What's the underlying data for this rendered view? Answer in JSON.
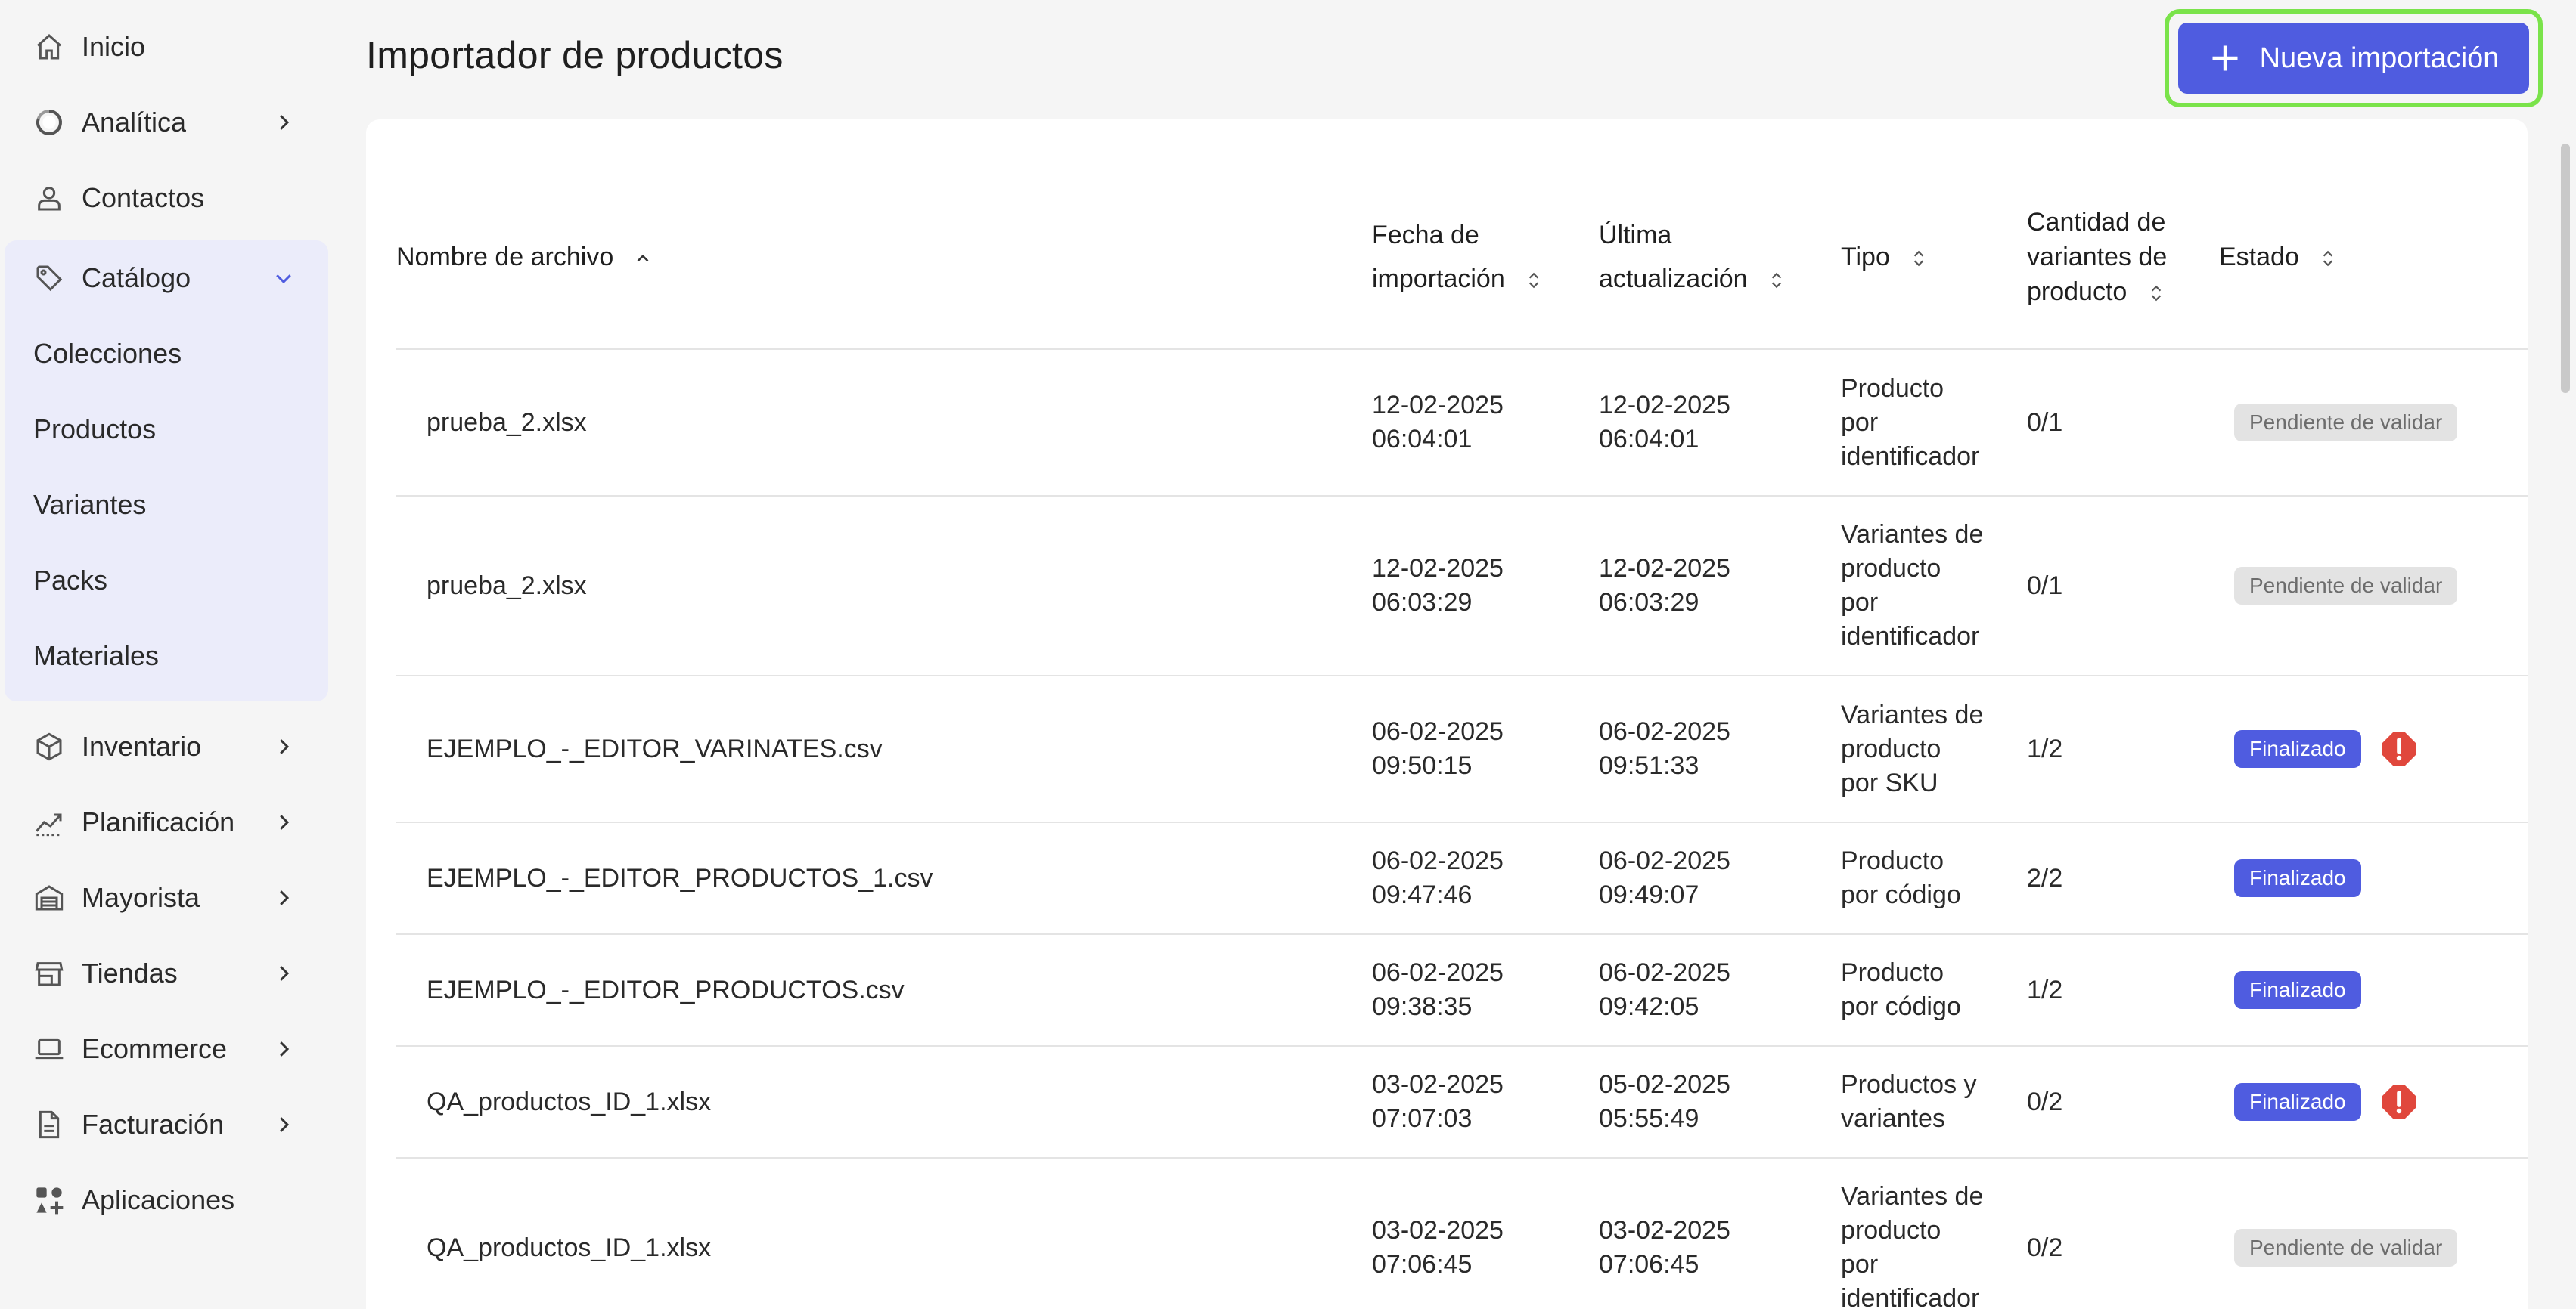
{
  "sidebar": {
    "items_top": [
      {
        "label": "Inicio",
        "icon": "home-icon",
        "chevron": false
      },
      {
        "label": "Analítica",
        "icon": "analytics-icon",
        "chevron": true
      },
      {
        "label": "Contactos",
        "icon": "user-icon",
        "chevron": false
      }
    ],
    "catalog": {
      "label": "Catálogo",
      "icon": "tag-icon",
      "sub_items": [
        "Colecciones",
        "Productos",
        "Variantes",
        "Packs",
        "Materiales"
      ]
    },
    "items_bottom": [
      {
        "label": "Inventario",
        "icon": "box-icon"
      },
      {
        "label": "Planificación",
        "icon": "trend-icon"
      },
      {
        "label": "Mayorista",
        "icon": "warehouse-icon"
      },
      {
        "label": "Tiendas",
        "icon": "store-icon"
      },
      {
        "label": "Ecommerce",
        "icon": "laptop-icon"
      },
      {
        "label": "Facturación",
        "icon": "document-icon"
      },
      {
        "label": "Aplicaciones",
        "icon": "apps-icon"
      }
    ]
  },
  "header": {
    "title": "Importador de productos",
    "new_button_label": "Nueva importación"
  },
  "table": {
    "columns": {
      "file": "Nombre de archivo",
      "import_date_1": "Fecha de",
      "import_date_2": "importación",
      "last_update_1": "Última",
      "last_update_2": "actualización",
      "type": "Tipo",
      "variants_1": "Cantidad de",
      "variants_2": "variantes de",
      "variants_3": "producto",
      "status": "Estado"
    },
    "rows": [
      {
        "file": "prueba_2.xlsx",
        "import_d": "12-02-2025",
        "import_t": "06:04:01",
        "update_d": "12-02-2025",
        "update_t": "06:04:01",
        "type_lines": [
          "Producto",
          "por",
          "identificador"
        ],
        "count": "0/1",
        "status": "Pendiente de validar",
        "status_kind": "pending",
        "warning": false
      },
      {
        "file": "prueba_2.xlsx",
        "import_d": "12-02-2025",
        "import_t": "06:03:29",
        "update_d": "12-02-2025",
        "update_t": "06:03:29",
        "type_lines": [
          "Variantes de",
          "producto",
          "por",
          "identificador"
        ],
        "count": "0/1",
        "status": "Pendiente de validar",
        "status_kind": "pending",
        "warning": false
      },
      {
        "file": "EJEMPLO_-_EDITOR_VARINATES.csv",
        "import_d": "06-02-2025",
        "import_t": "09:50:15",
        "update_d": "06-02-2025",
        "update_t": "09:51:33",
        "type_lines": [
          "Variantes de",
          "producto",
          "por SKU"
        ],
        "count": "1/2",
        "status": "Finalizado",
        "status_kind": "done",
        "warning": true
      },
      {
        "file": "EJEMPLO_-_EDITOR_PRODUCTOS_1.csv",
        "import_d": "06-02-2025",
        "import_t": "09:47:46",
        "update_d": "06-02-2025",
        "update_t": "09:49:07",
        "type_lines": [
          "Producto",
          "por código"
        ],
        "count": "2/2",
        "status": "Finalizado",
        "status_kind": "done",
        "warning": false
      },
      {
        "file": "EJEMPLO_-_EDITOR_PRODUCTOS.csv",
        "import_d": "06-02-2025",
        "import_t": "09:38:35",
        "update_d": "06-02-2025",
        "update_t": "09:42:05",
        "type_lines": [
          "Producto",
          "por código"
        ],
        "count": "1/2",
        "status": "Finalizado",
        "status_kind": "done",
        "warning": false
      },
      {
        "file": "QA_productos_ID_1.xlsx",
        "import_d": "03-02-2025",
        "import_t": "07:07:03",
        "update_d": "05-02-2025",
        "update_t": "05:55:49",
        "type_lines": [
          "Productos y",
          "variantes"
        ],
        "count": "0/2",
        "status": "Finalizado",
        "status_kind": "done",
        "warning": true
      },
      {
        "file": "QA_productos_ID_1.xlsx",
        "import_d": "03-02-2025",
        "import_t": "07:06:45",
        "update_d": "03-02-2025",
        "update_t": "07:06:45",
        "type_lines": [
          "Variantes de",
          "producto",
          "por",
          "identificador"
        ],
        "count": "0/2",
        "status": "Pendiente de validar",
        "status_kind": "pending",
        "warning": false
      }
    ]
  },
  "colors": {
    "accent": "#4f5ce0",
    "highlight": "#7ae34a",
    "warning": "#e0473c",
    "sidebar_group_bg": "#ebecfa"
  }
}
